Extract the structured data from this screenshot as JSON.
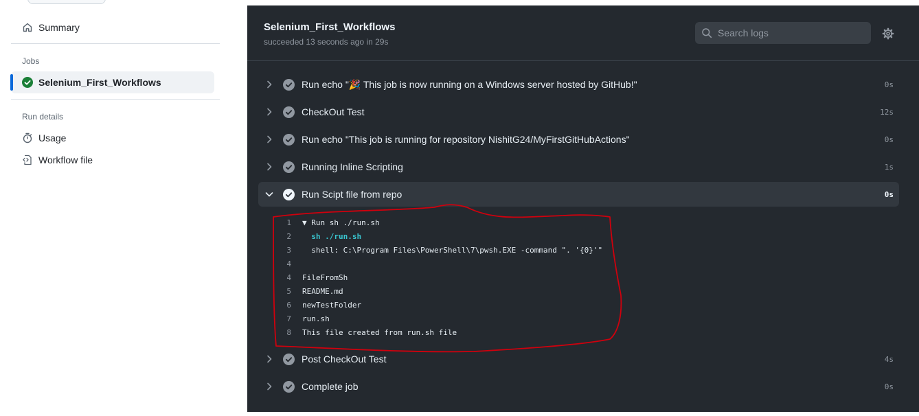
{
  "sidebar": {
    "summary_label": "Summary",
    "jobs_heading": "Jobs",
    "job_label": "Selenium_First_Workflows",
    "run_details_heading": "Run details",
    "usage_label": "Usage",
    "workflow_file_label": "Workflow file"
  },
  "job": {
    "title": "Selenium_First_Workflows",
    "status_text": "succeeded 13 seconds ago in 29s"
  },
  "search": {
    "placeholder": "Search logs"
  },
  "steps": [
    {
      "label": "Run echo \"🎉 This job is now running on a Windows server hosted by GitHub!\"",
      "duration": "0s"
    },
    {
      "label": "CheckOut Test",
      "duration": "12s"
    },
    {
      "label": "Run echo \"This job is running for repository NishitG24/MyFirstGitHubActions\"",
      "duration": "0s"
    },
    {
      "label": "Running Inline Scripting",
      "duration": "1s"
    },
    {
      "label": "Run Scipt file from repo",
      "duration": "0s"
    },
    {
      "label": "Post CheckOut Test",
      "duration": "4s"
    },
    {
      "label": "Complete job",
      "duration": "0s"
    }
  ],
  "log": [
    {
      "n": "1",
      "text": "▼ Run sh ./run.sh"
    },
    {
      "n": "2",
      "text": "  sh ./run.sh"
    },
    {
      "n": "3",
      "text": "  shell: C:\\Program Files\\PowerShell\\7\\pwsh.EXE -command \". '{0}'\""
    },
    {
      "n": "4",
      "text": ""
    },
    {
      "n": "4",
      "text": "FileFromSh"
    },
    {
      "n": "5",
      "text": "README.md"
    },
    {
      "n": "6",
      "text": "newTestFolder"
    },
    {
      "n": "7",
      "text": "run.sh"
    },
    {
      "n": "8",
      "text": "This file created from run.sh file"
    }
  ],
  "colors": {
    "success_green": "#1a7f37",
    "selected_indicator": "#0969da",
    "annotation_red": "#d0000d",
    "main_bg": "#24292f"
  },
  "icons": {
    "summary": "home-icon",
    "job_status": "check-circle-fill-icon",
    "usage": "stopwatch-icon",
    "workflow_file": "file-code-icon",
    "search": "search-icon",
    "settings": "gear-icon",
    "collapsed": "chevron-right-icon",
    "expanded": "chevron-down-icon",
    "step_status": "check-circle-fill-icon"
  }
}
